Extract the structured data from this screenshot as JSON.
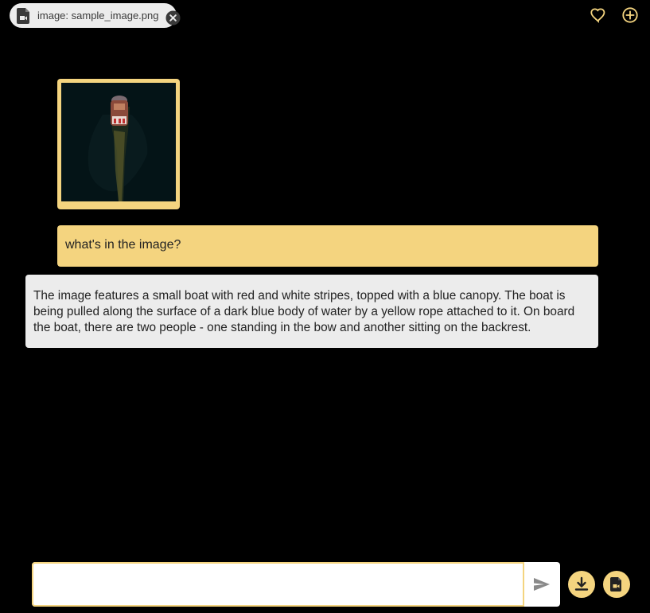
{
  "header": {
    "file_chip_label": "image: sample_image.png",
    "icons": [
      "file-icon",
      "close-icon",
      "heart-icon",
      "plus-circle-icon"
    ]
  },
  "conversation": {
    "user_message": "what's in the image?",
    "assistant_message": "The image features a small boat with red and white stripes, topped with a blue canopy. The boat is being pulled along the surface of a dark blue body of water by a yellow rope attached to it. On board the boat, there are two people - one standing in the bow and another sitting on the backrest."
  },
  "composer": {
    "value": "",
    "placeholder": ""
  },
  "colors": {
    "accent": "#f4d47f",
    "background": "#000000",
    "bubble_gray": "#ececec"
  }
}
